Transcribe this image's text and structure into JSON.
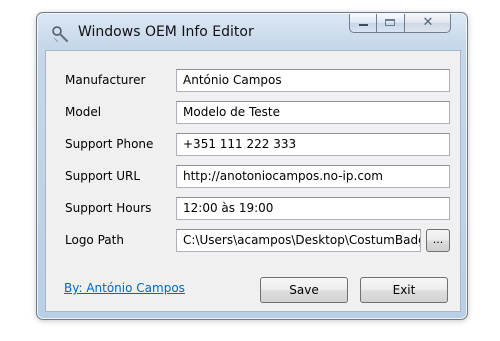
{
  "window": {
    "title": "Windows OEM Info Editor",
    "icon": "magnifier-wrench-icon",
    "close_glyph": "✕"
  },
  "form": {
    "fields": [
      {
        "label": "Manufacturer",
        "value": "António Campos"
      },
      {
        "label": "Model",
        "value": "Modelo de Teste"
      },
      {
        "label": "Support Phone",
        "value": "+351 111 222 333"
      },
      {
        "label": "Support URL",
        "value": "http://anotoniocampos.no-ip.com"
      },
      {
        "label": "Support Hours",
        "value": "12:00 às 19:00"
      },
      {
        "label": "Logo Path",
        "value": "C:\\Users\\acampos\\Desktop\\CostumBadge"
      }
    ],
    "browse_label": "..."
  },
  "footer": {
    "author_link": "By: António Campos",
    "save_label": "Save",
    "exit_label": "Exit"
  },
  "colors": {
    "link": "#0066cc",
    "window_frame": "#c6d7ea",
    "client_bg": "#f0f0f0"
  }
}
